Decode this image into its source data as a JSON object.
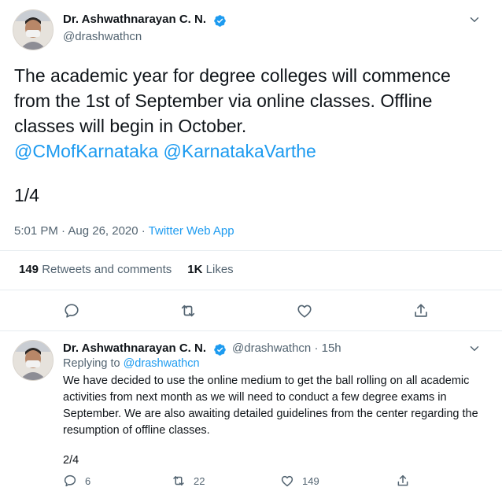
{
  "main_tweet": {
    "author_name": "Dr. Ashwathnarayan C. N.",
    "handle": "@drashwathcn",
    "text_plain": "The academic year for degree colleges will commence from the 1st of September via online classes. Offline classes will begin in October.",
    "mentions": [
      "@CMofKarnataka",
      "@KarnatakaVarthe"
    ],
    "thread_count": "1/4",
    "timestamp": "5:01 PM · Aug 26, 2020 · ",
    "source": "Twitter Web App",
    "retweets_count": "149",
    "retweets_label": "Retweets and comments",
    "likes_count": "1K",
    "likes_label": "Likes"
  },
  "reply_tweet": {
    "author_name": "Dr. Ashwathnarayan C. N.",
    "handle_time": "@drashwathcn · 15h",
    "replying_label": "Replying to ",
    "replying_to": "@drashwathcn",
    "text": "We have decided to use the online medium to get the ball rolling on all academic activities from next month as we will need to conduct a few degree exams in September. We are also awaiting detailed guidelines from the center regarding the resumption of offline classes.",
    "thread_count": "2/4",
    "reply_count": "6",
    "retweet_count": "22",
    "like_count": "149"
  },
  "icons": {
    "verified": "verified-badge-icon",
    "more": "chevron-down-icon",
    "reply": "reply-icon",
    "retweet": "retweet-icon",
    "like": "heart-icon",
    "share": "share-icon"
  },
  "colors": {
    "accent": "#1d9bf0",
    "text": "#0f1419",
    "muted": "#536471"
  }
}
